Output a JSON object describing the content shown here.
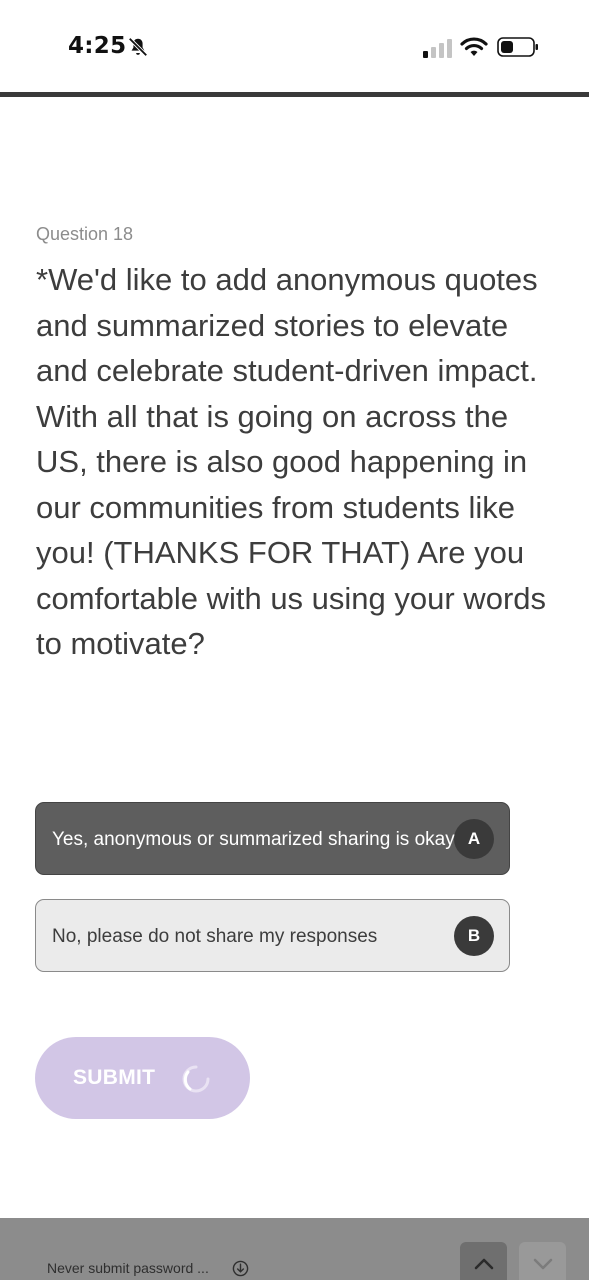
{
  "status_bar": {
    "time": "4:25",
    "icons": [
      "bell-slash-icon",
      "cellular-signal-icon",
      "wifi-icon",
      "battery-icon"
    ]
  },
  "progress": {
    "fraction": 1.0,
    "color": "#3a3a3a"
  },
  "question": {
    "number_label": "Question 18",
    "text": "*We'd like to add anonymous quotes and summarized stories to elevate and celebrate student-driven impact. With all that is going on across the US, there is also good happening in our communities from students like you! (THANKS FOR THAT) Are you comfortable with us using your words to motivate?"
  },
  "choices": [
    {
      "label": "Yes, anonymous or summarized sharing is okay",
      "key": "A",
      "selected": true
    },
    {
      "label": "No, please do not share my responses",
      "key": "B",
      "selected": false
    }
  ],
  "submit": {
    "label": "SUBMIT",
    "state": "loading",
    "color": "#d2c6e6"
  },
  "footer": {
    "note": "Never submit password ...",
    "nav_up_icon": "chevron-up-icon",
    "nav_down_icon": "chevron-down-icon"
  }
}
